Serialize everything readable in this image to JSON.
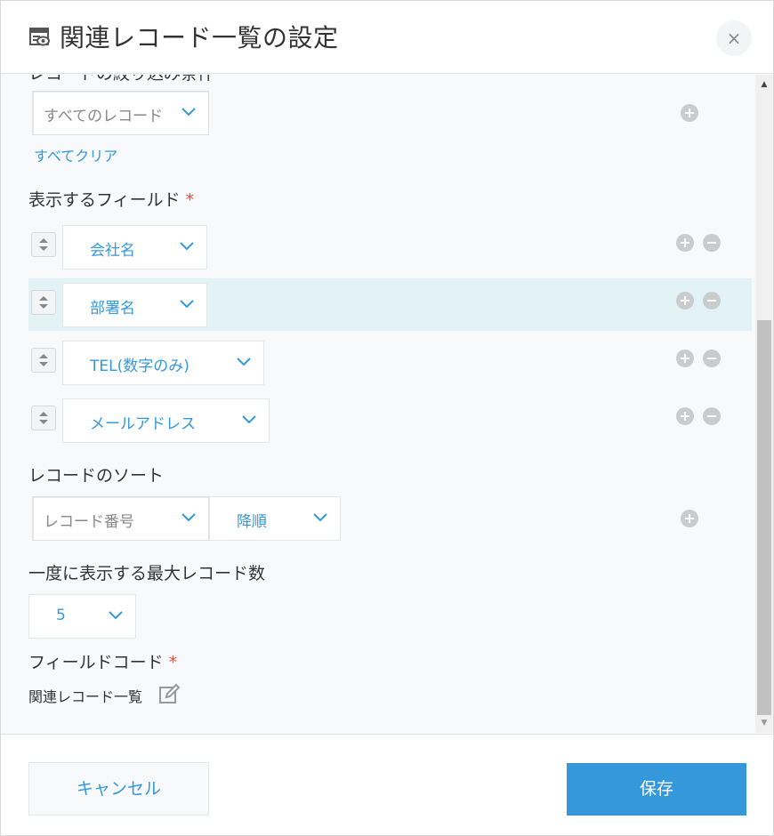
{
  "dialog": {
    "title": "関連レコード一覧の設定",
    "close_label": "×"
  },
  "filter": {
    "partial_label": "レコードの絞り込み条件",
    "condition_select": "すべてのレコード",
    "clear_all_link": "すべてクリア"
  },
  "display_fields": {
    "label": "表示するフィールド",
    "required_mark": "*",
    "items": [
      {
        "value": "会社名"
      },
      {
        "value": "部署名"
      },
      {
        "value": "TEL(数字のみ)"
      },
      {
        "value": "メールアドレス"
      }
    ]
  },
  "sort": {
    "label": "レコードのソート",
    "field_select": "レコード番号",
    "order_select": "降順"
  },
  "max_records": {
    "label": "一度に表示する最大レコード数",
    "value": "5"
  },
  "field_code": {
    "label": "フィールドコード",
    "required_mark": "*",
    "value": "関連レコード一覧"
  },
  "footer": {
    "cancel_label": "キャンセル",
    "save_label": "保存"
  },
  "colors": {
    "accent": "#3498db",
    "required": "#e74c3c",
    "highlight_row": "#e2f2f7"
  },
  "icons": {
    "header": "view-list-icon",
    "edit": "edit-pencil-icon",
    "chevron": "chevron-down-icon",
    "drag": "sort-handle-icon"
  }
}
